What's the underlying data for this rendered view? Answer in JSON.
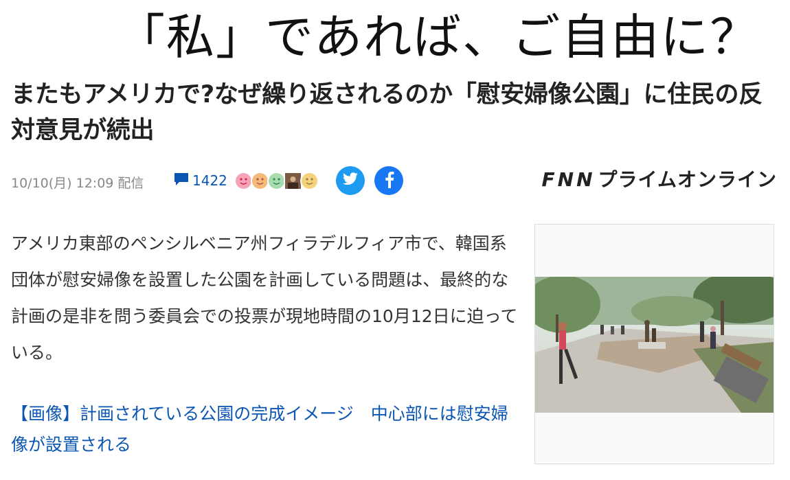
{
  "overlay_caption": "「私」であれば、ご自由に？",
  "article": {
    "headline": "またもアメリカで?なぜ繰り返されるのか「慰安婦像公園」に住民の反対意見が続出",
    "date": "10/10(月) 12:09 配信",
    "comment_count": "1422",
    "body": "アメリカ東部のペンシルベニア州フィラデルフィア市で、韓国系団体が慰安婦像を設置した公園を計画している問題は、最終的な計画の是非を問う委員会での投票が現地時間の10月12日に迫っている。",
    "image_link_text": "【画像】計画されている公園の完成イメージ　中心部には慰安婦像が設置される"
  },
  "brand": {
    "logo_prefix": "FNN",
    "logo_suffix": "プライムオンライン"
  },
  "share": {
    "twitter_icon": "twitter-bird-icon",
    "facebook_icon": "facebook-f-icon"
  },
  "reactions": {
    "icons": [
      "smiley-pink-icon",
      "smiley-orange-icon",
      "smiley-green-icon",
      "user-photo-icon",
      "smiley-yellow-icon"
    ]
  },
  "colors": {
    "link": "#0b56b3",
    "twitter": "#1d9bf0",
    "facebook": "#1877f2",
    "meta_text": "#888888"
  }
}
